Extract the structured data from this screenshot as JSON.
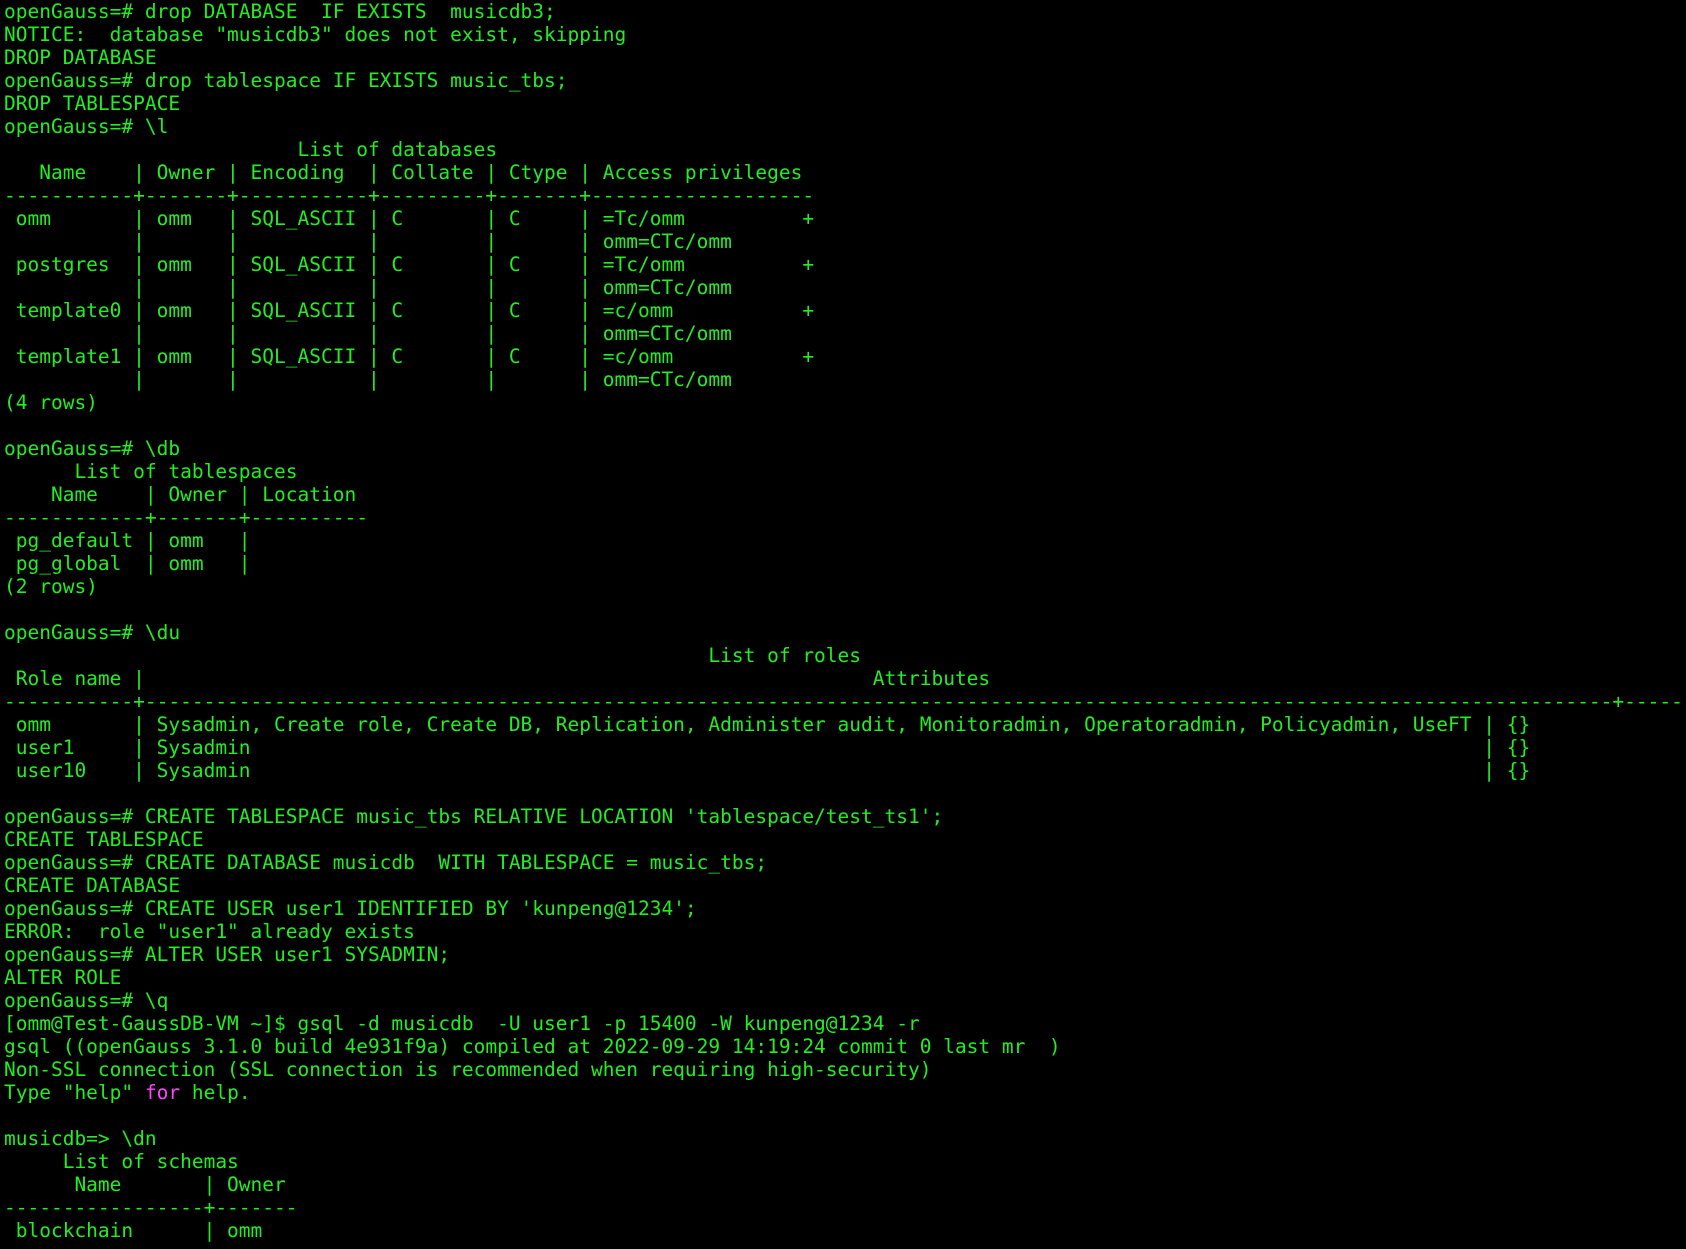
{
  "terminal": {
    "lines": [
      "openGauss=# drop DATABASE  IF EXISTS  musicdb3;",
      "NOTICE:  database \"musicdb3\" does not exist, skipping",
      "DROP DATABASE",
      "openGauss=# drop tablespace IF EXISTS music_tbs;",
      "DROP TABLESPACE",
      "openGauss=# \\l",
      "                         List of databases",
      "   Name    | Owner | Encoding  | Collate | Ctype | Access privileges",
      "-----------+-------+-----------+---------+-------+-------------------",
      " omm       | omm   | SQL_ASCII | C       | C     | =Tc/omm          +",
      "           |       |           |         |       | omm=CTc/omm",
      " postgres  | omm   | SQL_ASCII | C       | C     | =Tc/omm          +",
      "           |       |           |         |       | omm=CTc/omm",
      " template0 | omm   | SQL_ASCII | C       | C     | =c/omm           +",
      "           |       |           |         |       | omm=CTc/omm",
      " template1 | omm   | SQL_ASCII | C       | C     | =c/omm           +",
      "           |       |           |         |       | omm=CTc/omm",
      "(4 rows)",
      "",
      "openGauss=# \\db",
      "      List of tablespaces",
      "    Name    | Owner | Location",
      "------------+-------+----------",
      " pg_default | omm   |",
      " pg_global  | omm   |",
      "(2 rows)",
      "",
      "openGauss=# \\du",
      "                                                            List of roles",
      " Role name |                                                              Attributes                                                              | Member of",
      "-----------+-----------------------------------------------------------------------------------------------------------------------------+-----------",
      " omm       | Sysadmin, Create role, Create DB, Replication, Administer audit, Monitoradmin, Operatoradmin, Policyadmin, UseFT | {}",
      " user1     | Sysadmin                                                                                                         | {}",
      " user10    | Sysadmin                                                                                                         | {}",
      "",
      "openGauss=# CREATE TABLESPACE music_tbs RELATIVE LOCATION 'tablespace/test_ts1';",
      "CREATE TABLESPACE",
      "openGauss=# CREATE DATABASE musicdb  WITH TABLESPACE = music_tbs;",
      "CREATE DATABASE",
      "openGauss=# CREATE USER user1 IDENTIFIED BY 'kunpeng@1234';",
      "ERROR:  role \"user1\" already exists",
      "openGauss=# ALTER USER user1 SYSADMIN;",
      "ALTER ROLE",
      "openGauss=# \\q",
      "[omm@Test-GaussDB-VM ~]$ gsql -d musicdb  -U user1 -p 15400 -W kunpeng@1234 -r",
      "gsql ((openGauss 3.1.0 build 4e931f9a) compiled at 2022-09-29 14:19:24 commit 0 last mr  )",
      "Non-SSL connection (SSL connection is recommended when requiring high-security)"
    ],
    "help_line": {
      "prefix": "Type \"help\" ",
      "keyword": "for",
      "suffix": " help."
    },
    "tail_lines": [
      "",
      "musicdb=> \\dn",
      "     List of schemas",
      "      Name       | Owner",
      "-----------------+-------",
      " blockchain      | omm"
    ],
    "colors": {
      "background": "#000000",
      "text": "#22ee22",
      "keyword": "#ff44ff"
    }
  }
}
